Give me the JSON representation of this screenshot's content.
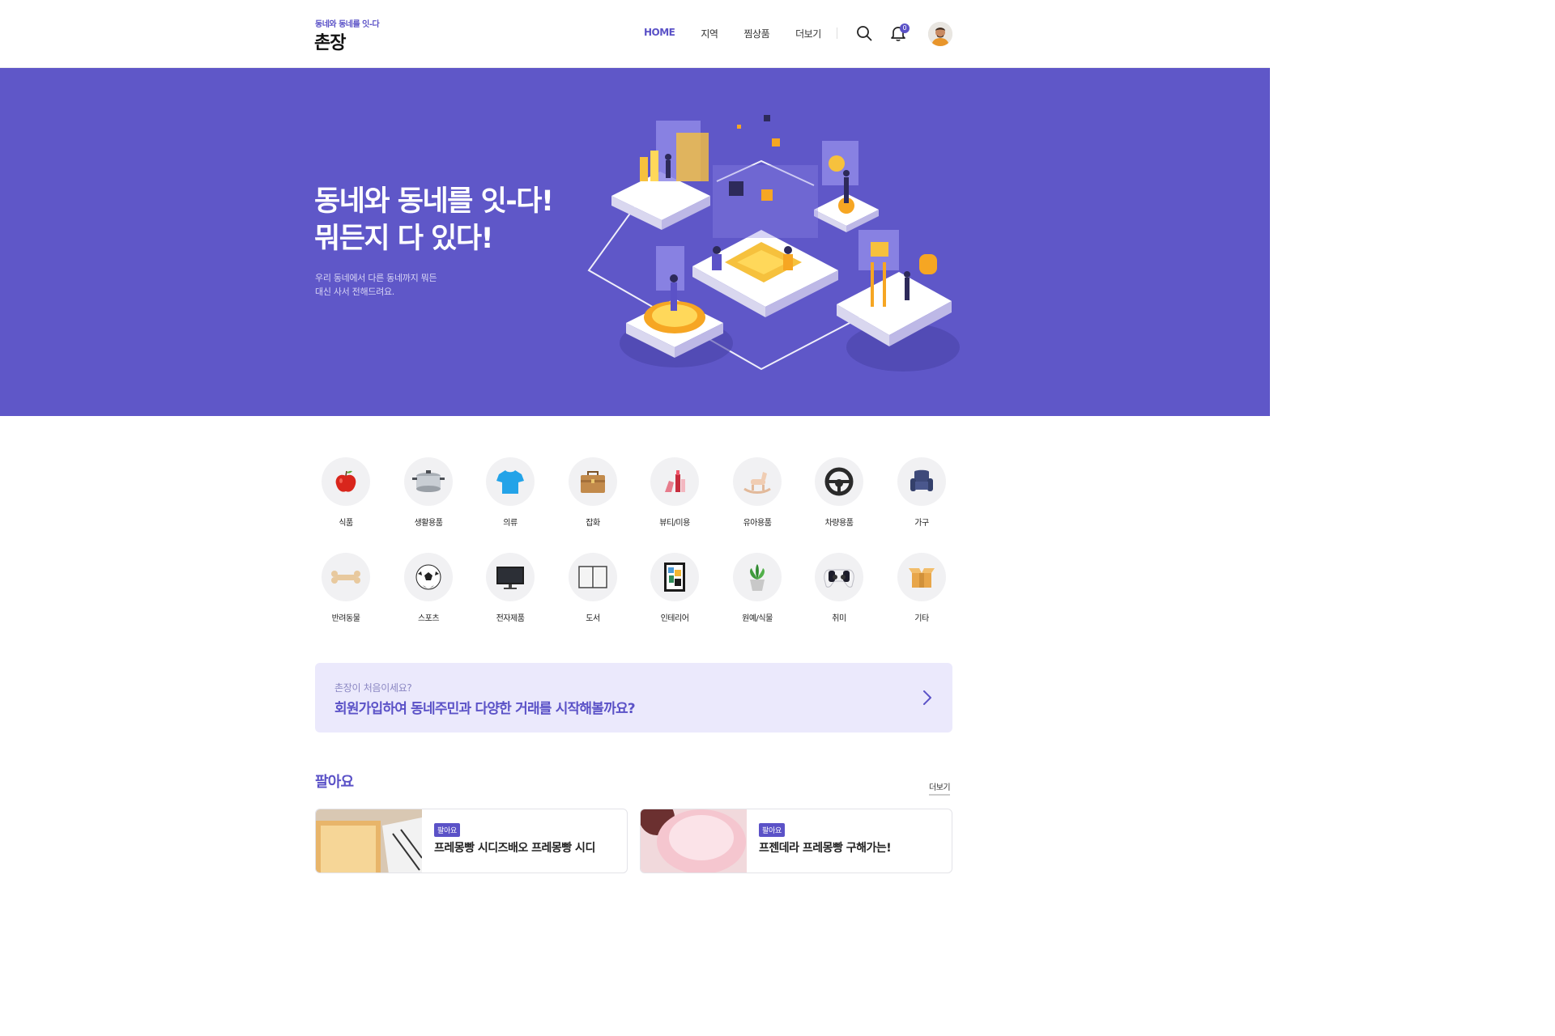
{
  "header": {
    "logo_sub": "동네와 동네를 잇-다",
    "logo": "촌장",
    "nav": [
      "HOME",
      "지역",
      "찜상품",
      "더보기"
    ],
    "notification_count": "0",
    "accent": "#5b52c7"
  },
  "hero": {
    "title": "동네와 동네를 잇-다!\n뭐든지 다 있다!",
    "description": "우리 동네에서 다른 동네까지 뭐든\n대신 사서 전해드려요.",
    "background": "#5f57c8"
  },
  "categories": [
    {
      "label": "식품",
      "icon": "apple-icon"
    },
    {
      "label": "생활용품",
      "icon": "pot-icon"
    },
    {
      "label": "의류",
      "icon": "tshirt-icon"
    },
    {
      "label": "잡화",
      "icon": "bag-icon"
    },
    {
      "label": "뷰티/미용",
      "icon": "cosmetics-icon"
    },
    {
      "label": "유아용품",
      "icon": "rocking-horse-icon"
    },
    {
      "label": "차량용품",
      "icon": "steering-wheel-icon"
    },
    {
      "label": "가구",
      "icon": "armchair-icon"
    },
    {
      "label": "반려동물",
      "icon": "bone-icon"
    },
    {
      "label": "스포츠",
      "icon": "soccer-ball-icon"
    },
    {
      "label": "전자제품",
      "icon": "monitor-icon"
    },
    {
      "label": "도서",
      "icon": "book-icon"
    },
    {
      "label": "인테리어",
      "icon": "frame-icon"
    },
    {
      "label": "원예/식물",
      "icon": "plant-icon"
    },
    {
      "label": "취미",
      "icon": "gamepad-icon"
    },
    {
      "label": "기타",
      "icon": "box-icon"
    }
  ],
  "banner": {
    "sub": "촌장이 처음이세요?",
    "main": "회원가입하여 동네주민과 다양한 거래를 시작해볼까요?"
  },
  "sell_section": {
    "title": "팔아요",
    "more": "더보기",
    "cards": [
      {
        "tag": "팔아요",
        "title": "프레몽빵 시디즈배오 프레몽빵 시디"
      },
      {
        "tag": "팔아요",
        "title": "프젠데라 프레몽빵 구해가는!"
      }
    ]
  }
}
